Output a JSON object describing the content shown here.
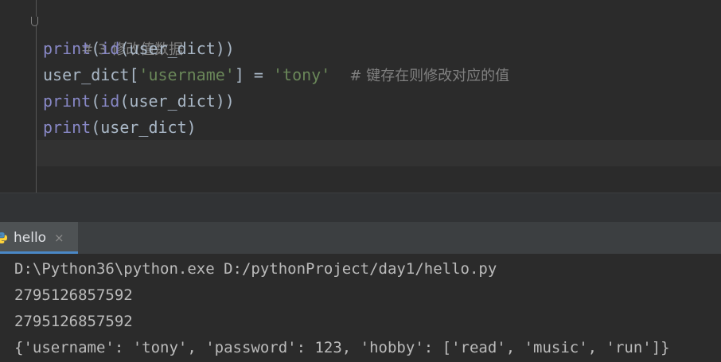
{
  "editor": {
    "comment_line": "# 3.修改值数据",
    "line2": {
      "fn": "print",
      "p1": "(",
      "fn2": "id",
      "arg": "(user_dict))"
    },
    "line3": {
      "var": "user_dict[",
      "key": "'username'",
      "mid": "] = ",
      "val": "'tony'",
      "comment": "# 键存在则修改对应的值"
    },
    "line4": {
      "fn": "print",
      "p1": "(",
      "fn2": "id",
      "arg": "(user_dict))"
    },
    "line5": {
      "fn": "print",
      "arg": "(user_dict)"
    }
  },
  "run_panel": {
    "tab_label": "hello",
    "close_glyph": "×",
    "output": [
      "D:\\Python36\\python.exe D:/pythonProject/day1/hello.py",
      "2795126857592",
      "2795126857592",
      "{'username': 'tony', 'password': 123, 'hobby': ['read', 'music', 'run']}"
    ]
  },
  "icons": {
    "tab_icon": "python-icon",
    "fold_icon": "fold-marker-icon"
  },
  "colors": {
    "background": "#2b2b2b",
    "builtin": "#8888c6",
    "string": "#6a8759",
    "comment": "#808080",
    "tab_underline": "#4a88c7"
  }
}
